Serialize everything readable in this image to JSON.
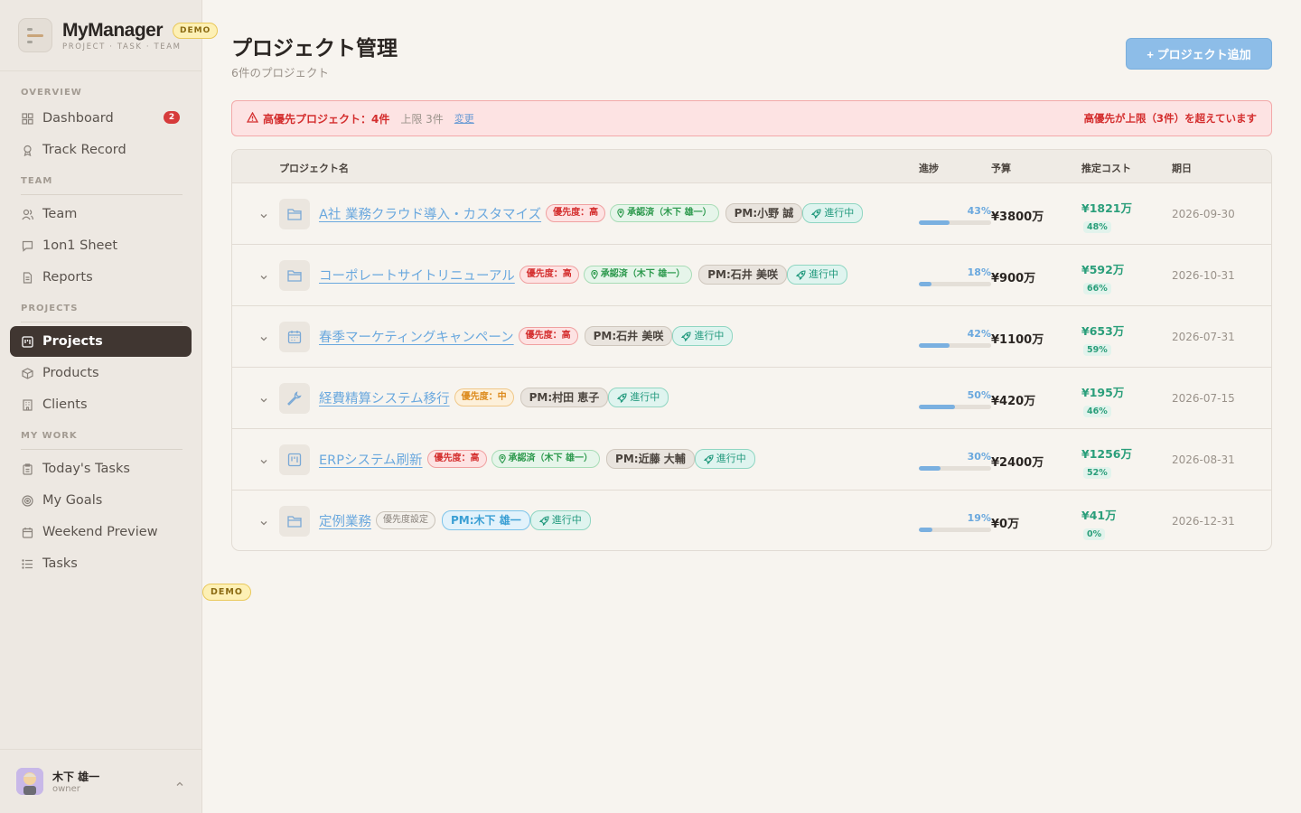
{
  "brand": {
    "title": "MyManager",
    "subtitle": "PROJECT · TASK · TEAM",
    "badge": "DEMO"
  },
  "colors": {
    "accent": "#8dbde8",
    "active_nav": "#403631",
    "danger": "#d42e2e",
    "success": "#2a9e7a"
  },
  "nav": {
    "sections": [
      {
        "label": "OVERVIEW",
        "items": [
          {
            "label": "Dashboard",
            "icon": "grid-icon",
            "badge": "2"
          },
          {
            "label": "Track Record",
            "icon": "award-icon"
          }
        ]
      },
      {
        "label": "TEAM",
        "items": [
          {
            "label": "Team",
            "icon": "users-icon"
          },
          {
            "label": "1on1 Sheet",
            "icon": "chat-icon"
          },
          {
            "label": "Reports",
            "icon": "document-icon"
          }
        ]
      },
      {
        "label": "PROJECTS",
        "items": [
          {
            "label": "Projects",
            "icon": "kanban-icon",
            "active": true
          },
          {
            "label": "Products",
            "icon": "box-icon"
          },
          {
            "label": "Clients",
            "icon": "building-icon"
          }
        ]
      },
      {
        "label": "MY WORK",
        "items": [
          {
            "label": "Today's Tasks",
            "icon": "clipboard-icon"
          },
          {
            "label": "My Goals",
            "icon": "target-icon"
          },
          {
            "label": "Weekend Preview",
            "icon": "calendar-icon"
          },
          {
            "label": "Tasks",
            "icon": "list-icon"
          }
        ]
      }
    ]
  },
  "user": {
    "name": "木下 雄一",
    "role": "owner"
  },
  "page": {
    "title": "プロジェクト管理",
    "subtitle": "6件のプロジェクト",
    "add_button": "+ プロジェクト追加"
  },
  "alert": {
    "title": "高優先プロジェクト：4件",
    "limit": "上限 3件",
    "change": "変更",
    "right": "高優先が上限（3件）を超えています"
  },
  "table": {
    "headers": {
      "name": "プロジェクト名",
      "progress": "進捗",
      "budget": "予算",
      "cost": "推定コスト",
      "due": "期日"
    },
    "rows": [
      {
        "icon": "folder-icon",
        "name": "A社 業務クラウド導入・カスタマイズ",
        "priority": "優先度：高",
        "priority_level": "high",
        "approved": "承認済（木下 雄一）",
        "pm": "PM:小野 誠",
        "pm_owner": false,
        "status": "進行中",
        "progress": 43,
        "progress_label": "43%",
        "budget": "¥3800万",
        "cost": "¥1821万",
        "cost_pct": "48%",
        "due": "2026-09-30"
      },
      {
        "icon": "folder-icon",
        "name": "コーポレートサイトリニューアル",
        "priority": "優先度：高",
        "priority_level": "high",
        "approved": "承認済（木下 雄一）",
        "pm": "PM:石井 美咲",
        "pm_owner": false,
        "status": "進行中",
        "progress": 18,
        "progress_label": "18%",
        "budget": "¥900万",
        "cost": "¥592万",
        "cost_pct": "66%",
        "due": "2026-10-31"
      },
      {
        "icon": "calendar-icon",
        "name": "春季マーケティングキャンペーン",
        "priority": "優先度：高",
        "priority_level": "high",
        "approved": "",
        "pm": "PM:石井 美咲",
        "pm_owner": false,
        "status": "進行中",
        "progress": 42,
        "progress_label": "42%",
        "budget": "¥1100万",
        "cost": "¥653万",
        "cost_pct": "59%",
        "due": "2026-07-31"
      },
      {
        "icon": "wrench-icon",
        "name": "経費精算システム移行",
        "priority": "優先度：中",
        "priority_level": "mid",
        "approved": "",
        "pm": "PM:村田 恵子",
        "pm_owner": false,
        "status": "進行中",
        "progress": 50,
        "progress_label": "50%",
        "budget": "¥420万",
        "cost": "¥195万",
        "cost_pct": "46%",
        "due": "2026-07-15"
      },
      {
        "icon": "kanban-icon",
        "name": "ERPシステム刷新",
        "priority": "優先度：高",
        "priority_level": "high",
        "approved": "承認済（木下 雄一）",
        "pm": "PM:近藤 大輔",
        "pm_owner": false,
        "status": "進行中",
        "progress": 30,
        "progress_label": "30%",
        "budget": "¥2400万",
        "cost": "¥1256万",
        "cost_pct": "52%",
        "due": "2026-08-31"
      },
      {
        "icon": "folder-icon",
        "name": "定例業務",
        "priority": "優先度設定",
        "priority_level": "none",
        "approved": "",
        "pm": "PM:木下 雄一",
        "pm_owner": true,
        "status": "進行中",
        "progress": 19,
        "progress_label": "19%",
        "budget": "¥0万",
        "cost": "¥41万",
        "cost_pct": "0%",
        "due": "2026-12-31"
      }
    ]
  },
  "demo_float": "DEMO"
}
